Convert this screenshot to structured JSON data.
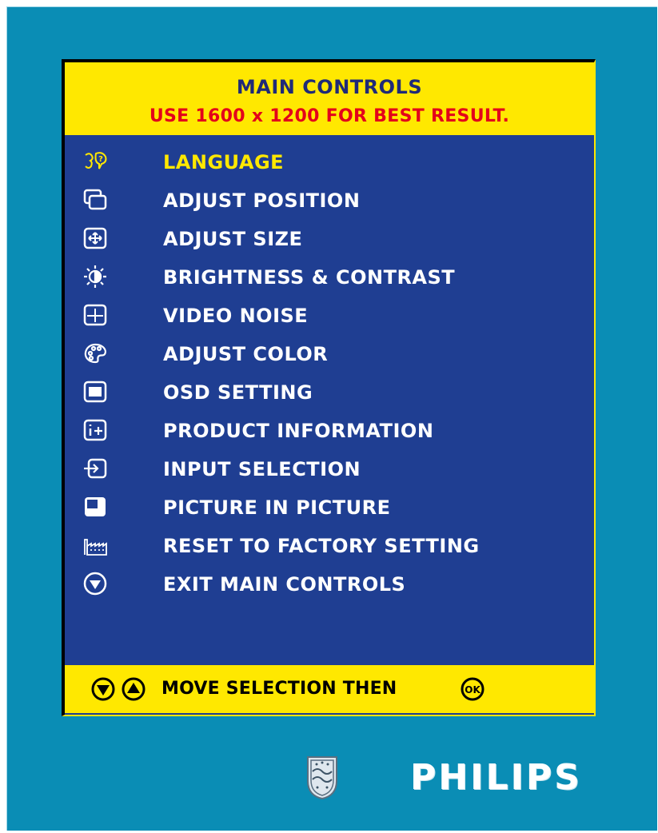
{
  "osd": {
    "title": "MAIN CONTROLS",
    "subtitle": "USE 1600 x 1200 FOR BEST RESULT.",
    "items": [
      {
        "label": "LANGUAGE",
        "icon": "language-icon",
        "selected": true
      },
      {
        "label": "ADJUST POSITION",
        "icon": "adjust-position-icon"
      },
      {
        "label": "ADJUST SIZE",
        "icon": "adjust-size-icon"
      },
      {
        "label": "BRIGHTNESS & CONTRAST",
        "icon": "brightness-icon"
      },
      {
        "label": "VIDEO NOISE",
        "icon": "video-noise-icon"
      },
      {
        "label": "ADJUST COLOR",
        "icon": "palette-icon"
      },
      {
        "label": "OSD SETTING",
        "icon": "osd-setting-icon"
      },
      {
        "label": "PRODUCT INFORMATION",
        "icon": "info-icon"
      },
      {
        "label": "INPUT SELECTION",
        "icon": "input-icon"
      },
      {
        "label": "PICTURE IN PICTURE",
        "icon": "pip-icon"
      },
      {
        "label": "RESET TO FACTORY SETTING",
        "icon": "factory-icon"
      },
      {
        "label": "EXIT MAIN CONTROLS",
        "icon": "exit-icon"
      }
    ],
    "footer_text": "MOVE SELECTION THEN",
    "footer_ok": "OK"
  },
  "brand": {
    "name": "PHILIPS"
  },
  "colors": {
    "background": "#0a8db5",
    "panel": "#1f3e92",
    "header": "#ffe800",
    "title": "#1f2a78",
    "subtitle": "#e3001b",
    "selected": "#ffe800"
  }
}
